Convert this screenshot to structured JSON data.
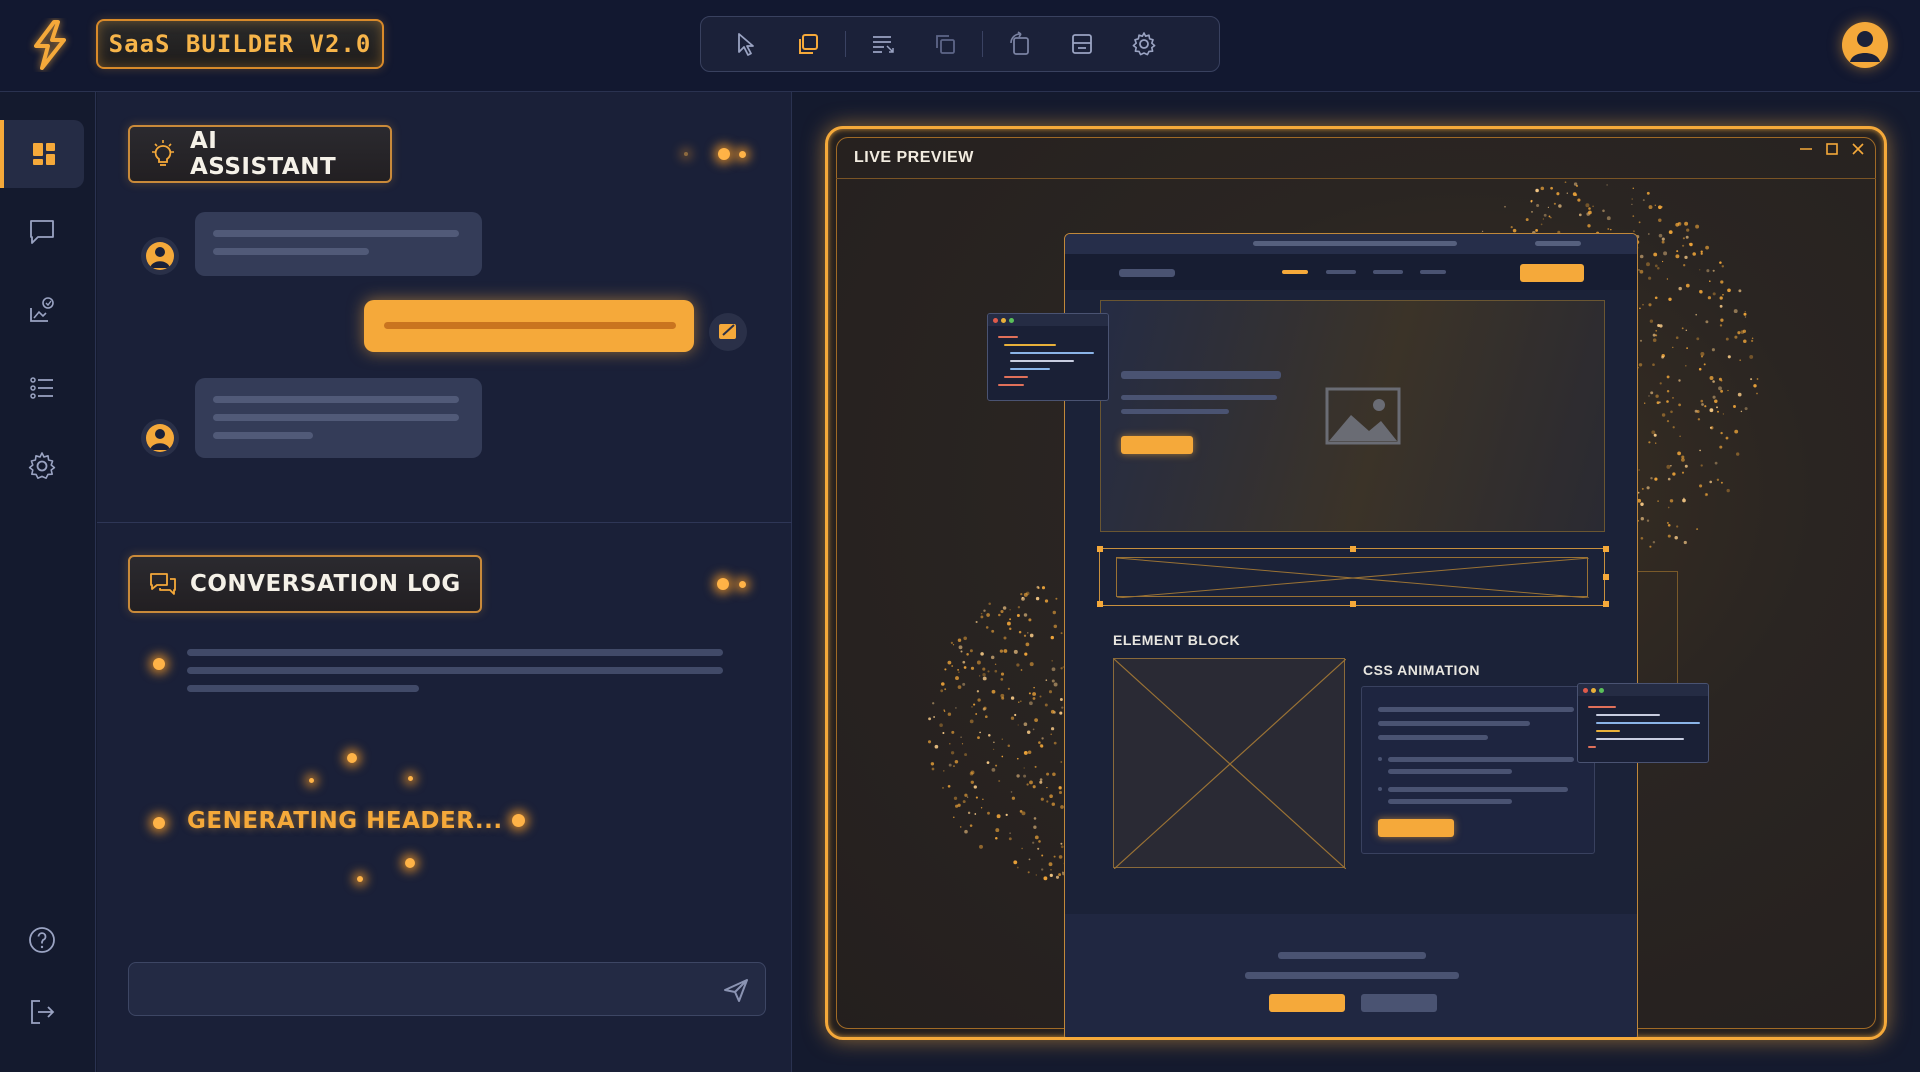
{
  "app": {
    "brand_label": "SaaS BUILDER V2.0"
  },
  "toolbar": {
    "tools": [
      {
        "icon": "cursor-icon"
      },
      {
        "icon": "copy-icon"
      },
      {
        "icon": "text-align-icon"
      },
      {
        "icon": "duplicate-icon"
      },
      {
        "icon": "rotate-icon"
      },
      {
        "icon": "layout-icon"
      },
      {
        "icon": "gear-icon"
      }
    ]
  },
  "sidebar": {
    "items": [
      {
        "icon": "dashboard-icon",
        "active": true
      },
      {
        "icon": "chat-icon",
        "active": false
      },
      {
        "icon": "image-edit-icon",
        "active": false
      },
      {
        "icon": "list-icon",
        "active": false
      },
      {
        "icon": "settings-icon",
        "active": false
      }
    ],
    "bottom": [
      {
        "icon": "help-icon"
      },
      {
        "icon": "logout-icon"
      }
    ]
  },
  "assistant": {
    "title": "AI ASSISTANT",
    "icon": "lightbulb-icon"
  },
  "log": {
    "title": "CONVERSATION LOG",
    "icon": "chat-bubbles-icon",
    "status": "GENERATING HEADER..."
  },
  "input": {
    "value": "",
    "placeholder": ""
  },
  "preview": {
    "title": "LIVE PREVIEW",
    "element_block_label": "ELEMENT BLOCK",
    "css_animation_label": "CSS ANIMATION"
  },
  "colors": {
    "accent": "#f5a93a",
    "background": "#141a2e",
    "panel": "#1a2038"
  }
}
